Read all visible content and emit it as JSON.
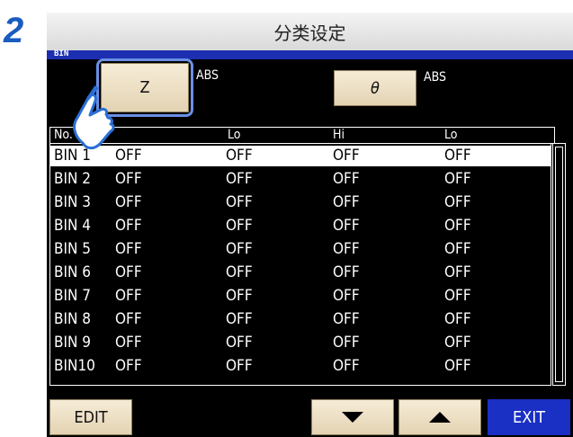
{
  "step_number": "2",
  "title": "分类设定",
  "section_label": "BIN",
  "param_buttons": [
    {
      "label": "Z",
      "mode": "ABS"
    },
    {
      "label": "θ",
      "mode": "ABS"
    }
  ],
  "table": {
    "headers": [
      "No.",
      "Lo",
      "Hi",
      "Lo"
    ],
    "rows": [
      {
        "name": "BIN 1",
        "c1": "OFF",
        "c2": "OFF",
        "c3": "OFF",
        "c4": "OFF"
      },
      {
        "name": "BIN 2",
        "c1": "OFF",
        "c2": "OFF",
        "c3": "OFF",
        "c4": "OFF"
      },
      {
        "name": "BIN 3",
        "c1": "OFF",
        "c2": "OFF",
        "c3": "OFF",
        "c4": "OFF"
      },
      {
        "name": "BIN 4",
        "c1": "OFF",
        "c2": "OFF",
        "c3": "OFF",
        "c4": "OFF"
      },
      {
        "name": "BIN 5",
        "c1": "OFF",
        "c2": "OFF",
        "c3": "OFF",
        "c4": "OFF"
      },
      {
        "name": "BIN 6",
        "c1": "OFF",
        "c2": "OFF",
        "c3": "OFF",
        "c4": "OFF"
      },
      {
        "name": "BIN 7",
        "c1": "OFF",
        "c2": "OFF",
        "c3": "OFF",
        "c4": "OFF"
      },
      {
        "name": "BIN 8",
        "c1": "OFF",
        "c2": "OFF",
        "c3": "OFF",
        "c4": "OFF"
      },
      {
        "name": "BIN 9",
        "c1": "OFF",
        "c2": "OFF",
        "c3": "OFF",
        "c4": "OFF"
      },
      {
        "name": "BIN10",
        "c1": "OFF",
        "c2": "OFF",
        "c3": "OFF",
        "c4": "OFF"
      }
    ]
  },
  "footer": {
    "edit_label": "EDIT",
    "down_icon": "triangle-down-icon",
    "up_icon": "triangle-up-icon",
    "exit_label": "EXIT"
  },
  "colors": {
    "step_number": "#1a5cbf",
    "section_bar": "#1c2fb0",
    "exit_button": "#1a2fc4",
    "highlight_ring": "#6a8fe6",
    "hand_outline": "#2a6fd6",
    "button_face": "#efe2c7"
  }
}
